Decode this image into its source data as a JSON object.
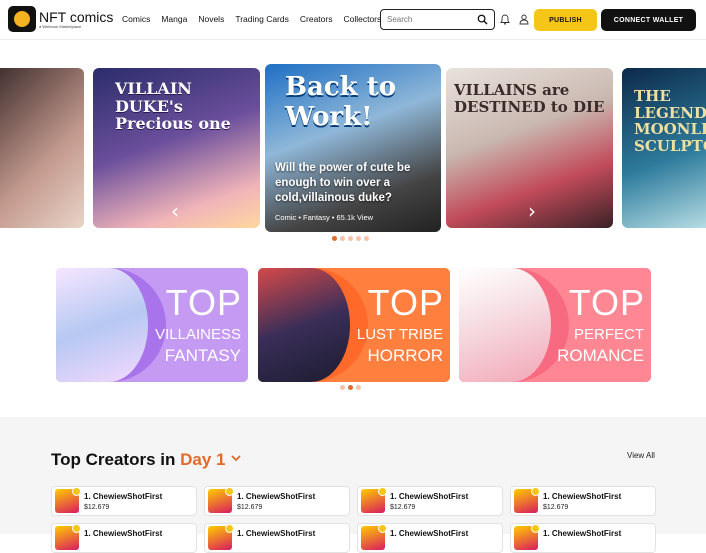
{
  "header": {
    "logo_title": "NFT comics",
    "logo_subtitle": "a Webtoon Marketplace",
    "nav": [
      "Comics",
      "Manga",
      "Novels",
      "Trading Cards",
      "Creators",
      "Collectors"
    ],
    "search_placeholder": "Search",
    "publish_label": "PUBLISH",
    "connect_label": "CONNECT WALLET"
  },
  "carousel": {
    "slides": [
      {
        "deco": ""
      },
      {
        "deco": "VILLAIN DUKE's Precious one"
      },
      {
        "deco": "Back to Work!"
      },
      {
        "deco": "VILLAINS are DESTINED to DIE"
      },
      {
        "deco": "THE LEGENDARY MOONLIGHT SCULPTOR"
      }
    ],
    "featured_title": "Will the power of cute be enough to win over a cold,villainous duke?",
    "featured_meta": "Comic • Fantasy • 65.1k View",
    "dot_count": 5,
    "active_dot": 0
  },
  "banners": [
    {
      "top": "TOP",
      "genre1": "VILLAINESS",
      "genre2": "FANTASY"
    },
    {
      "top": "TOP",
      "genre1": "LUST TRIBE",
      "genre2": "HORROR"
    },
    {
      "top": "TOP",
      "genre1": "PERFECT",
      "genre2": "ROMANCE"
    }
  ],
  "banner_dots": {
    "count": 3,
    "active": 1
  },
  "creators": {
    "title_prefix": "Top Creators in",
    "day": "Day 1",
    "view_all": "View All",
    "cards": [
      {
        "name": "1. ChewiewShotFirst",
        "price": "$12.679"
      },
      {
        "name": "1. ChewiewShotFirst",
        "price": "$12.679"
      },
      {
        "name": "1. ChewiewShotFirst",
        "price": "$12.679"
      },
      {
        "name": "1. ChewiewShotFirst",
        "price": "$12.679"
      },
      {
        "name": "1. ChewiewShotFirst",
        "price": ""
      },
      {
        "name": "1. ChewiewShotFirst",
        "price": ""
      },
      {
        "name": "1. ChewiewShotFirst",
        "price": ""
      },
      {
        "name": "1. ChewiewShotFirst",
        "price": ""
      }
    ]
  },
  "colors": {
    "accent": "#f5c518",
    "orange": "#e06b2a",
    "dark": "#111111"
  }
}
